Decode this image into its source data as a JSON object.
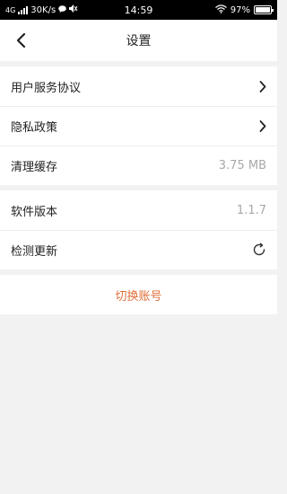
{
  "status_bar": {
    "network": "4G",
    "speed": "30K/s",
    "time": "14:59",
    "battery": "97%",
    "battery_level": 0.97
  },
  "nav": {
    "title": "设置"
  },
  "group1": [
    {
      "label": "用户服务协议"
    },
    {
      "label": "隐私政策"
    },
    {
      "label": "清理缓存",
      "value": "3.75 MB"
    }
  ],
  "group2": [
    {
      "label": "软件版本",
      "value": "1.1.7"
    },
    {
      "label": "检测更新"
    }
  ],
  "switch_account": "切换账号",
  "colors": {
    "accent": "#e0703a",
    "background": "#f2f2f2",
    "value_text": "#a8a8a8"
  }
}
